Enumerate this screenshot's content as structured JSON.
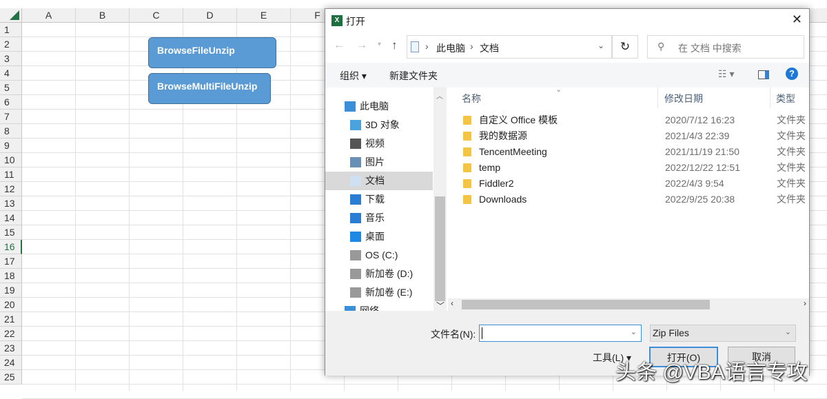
{
  "sheet": {
    "columns": [
      "A",
      "B",
      "C",
      "D",
      "E",
      "F"
    ],
    "rows": [
      "1",
      "2",
      "3",
      "4",
      "5",
      "6",
      "7",
      "8",
      "9",
      "10",
      "11",
      "12",
      "13",
      "14",
      "15",
      "16",
      "17",
      "18",
      "19",
      "20",
      "21",
      "22",
      "23",
      "24",
      "25"
    ],
    "selected_row": "16",
    "buttons": [
      "BrowseFileUnzip",
      "BrowseMultiFileUnzip"
    ],
    "accent": "#217346"
  },
  "dialog": {
    "title": "打开",
    "close": "✕",
    "breadcrumb": [
      "此电脑",
      "文档"
    ],
    "search_placeholder": "在 文档 中搜索",
    "toolbar": {
      "organize": "组织 ▾",
      "new_folder": "新建文件夹"
    },
    "nav": [
      {
        "label": "此电脑",
        "icon": "computer-icon"
      },
      {
        "label": "3D 对象",
        "icon": "cube-icon"
      },
      {
        "label": "视频",
        "icon": "video-icon"
      },
      {
        "label": "图片",
        "icon": "picture-icon"
      },
      {
        "label": "文档",
        "icon": "document-icon"
      },
      {
        "label": "下载",
        "icon": "download-icon"
      },
      {
        "label": "音乐",
        "icon": "music-icon"
      },
      {
        "label": "桌面",
        "icon": "desktop-icon"
      },
      {
        "label": "OS (C:)",
        "icon": "drive-icon"
      },
      {
        "label": "新加卷 (D:)",
        "icon": "drive-icon"
      },
      {
        "label": "新加卷 (E:)",
        "icon": "drive-icon"
      },
      {
        "label": "网络",
        "icon": "network-icon"
      }
    ],
    "selected_nav": "文档",
    "columns": {
      "name": "名称",
      "date": "修改日期",
      "type": "类型"
    },
    "files": [
      {
        "name": "自定义 Office 模板",
        "date": "2020/7/12 16:23",
        "type": "文件夹"
      },
      {
        "name": "我的数据源",
        "date": "2021/4/3 22:39",
        "type": "文件夹"
      },
      {
        "name": "TencentMeeting",
        "date": "2021/11/19 21:50",
        "type": "文件夹"
      },
      {
        "name": "temp",
        "date": "2022/12/22 12:51",
        "type": "文件夹"
      },
      {
        "name": "Fiddler2",
        "date": "2022/4/3 9:54",
        "type": "文件夹"
      },
      {
        "name": "Downloads",
        "date": "2022/9/25 20:38",
        "type": "文件夹"
      }
    ],
    "filename_label": "文件名(N):",
    "filename_value": "",
    "filter": "Zip Files",
    "tools": "工具(L)",
    "open": "打开(O)",
    "cancel": "取消"
  },
  "watermark": "头条 @VBA语言专攻"
}
